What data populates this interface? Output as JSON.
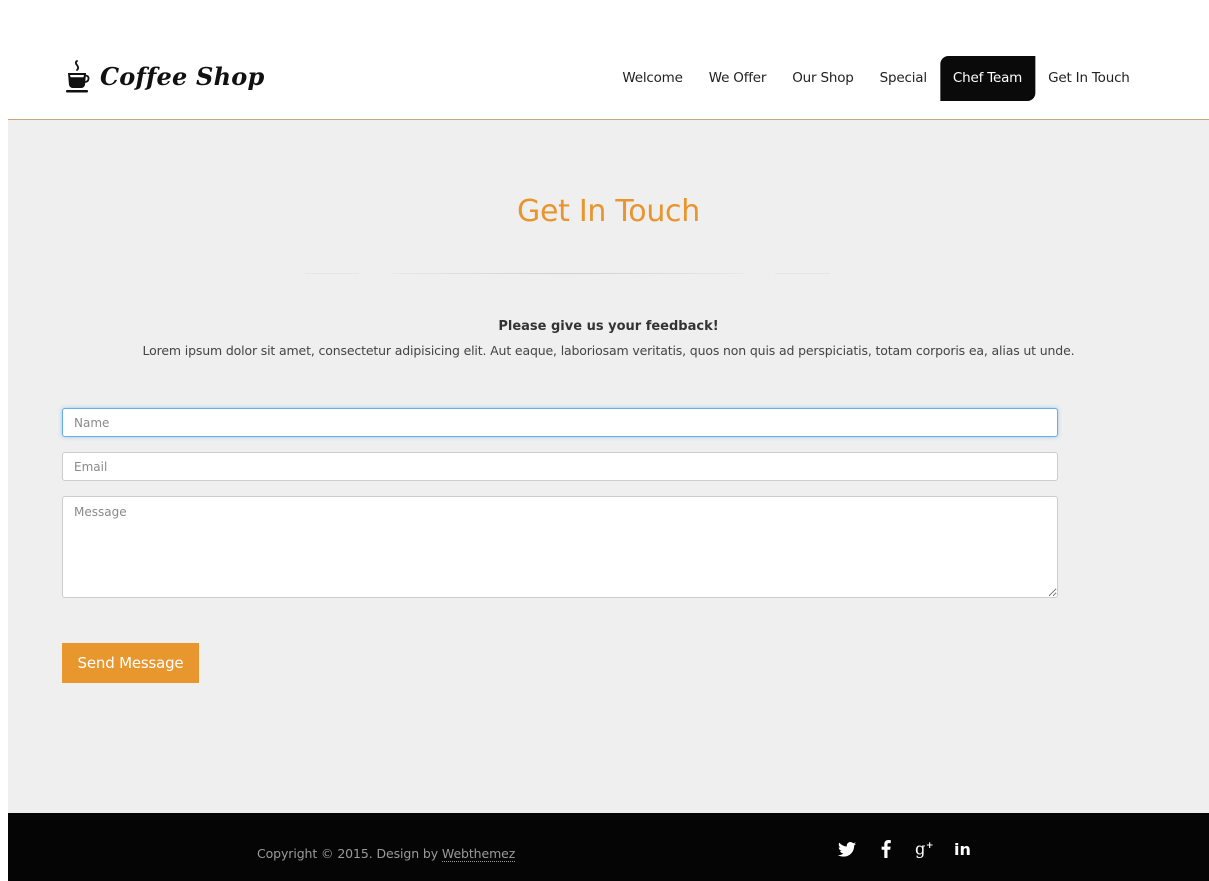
{
  "header": {
    "brand": "Coffee Shop",
    "nav": [
      {
        "label": "Welcome",
        "active": false
      },
      {
        "label": "We Offer",
        "active": false
      },
      {
        "label": "Our Shop",
        "active": false
      },
      {
        "label": "Special",
        "active": false
      },
      {
        "label": "Chef Team",
        "active": true
      },
      {
        "label": "Get In Touch",
        "active": false
      }
    ]
  },
  "contact": {
    "title": "Get In Touch",
    "feedback_title": "Please give us your feedback!",
    "feedback_desc": "Lorem ipsum dolor sit amet, consectetur adipisicing elit. Aut eaque, laboriosam veritatis, quos non quis ad perspiciatis, totam corporis ea, alias ut unde.",
    "name_placeholder": "Name",
    "email_placeholder": "Email",
    "message_placeholder": "Message",
    "send_label": "Send Message"
  },
  "footer": {
    "copyright_prefix": "Copyright © 2015. Design by ",
    "copyright_link": "Webthemez",
    "social": [
      "twitter-icon",
      "facebook-icon",
      "google-plus-icon",
      "linkedin-icon"
    ]
  },
  "colors": {
    "accent": "#e8962e",
    "nav_active_bg": "#000000",
    "main_bg": "#efefef",
    "footer_bg": "#050505"
  }
}
